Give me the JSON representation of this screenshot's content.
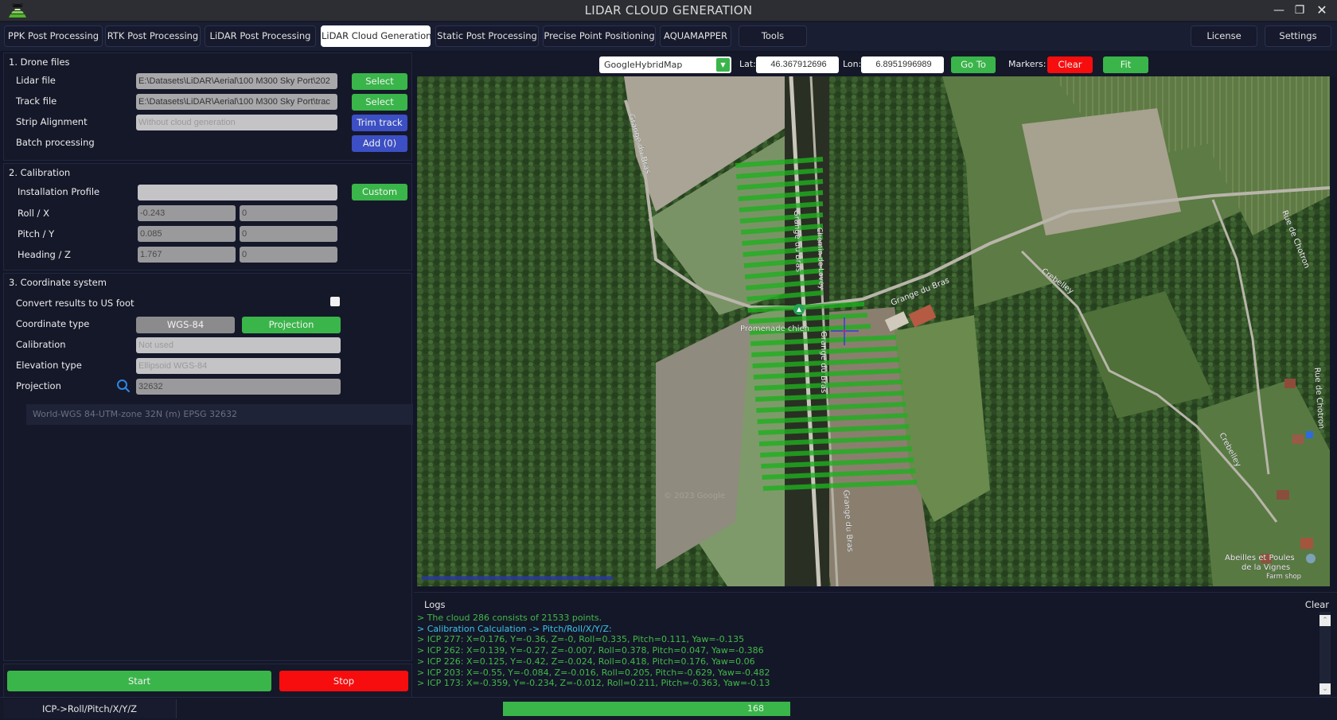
{
  "window": {
    "title": "LIDAR CLOUD GENERATION",
    "controls": {
      "minimize": "—",
      "restore": "❐",
      "close": "✕"
    }
  },
  "tabs": [
    {
      "label": "PPK Post Processing",
      "active": false
    },
    {
      "label": "RTK Post Processing",
      "active": false
    },
    {
      "label": "LiDAR Post Processing",
      "active": false
    },
    {
      "label": "LiDAR Cloud Generation",
      "active": true
    },
    {
      "label": "Static Post Processing",
      "active": false
    },
    {
      "label": "Precise Point Positioning",
      "active": false
    },
    {
      "label": "AQUAMAPPER",
      "active": false
    },
    {
      "label": "Tools",
      "active": false
    }
  ],
  "right_tabs": [
    {
      "label": "License"
    },
    {
      "label": "Settings"
    }
  ],
  "drone_files": {
    "title": "1. Drone files",
    "lidar_file": {
      "label": "Lidar file",
      "value": "E:\\Datasets\\LiDAR\\Aerial\\100 M300 Sky Port\\202",
      "button": "Select"
    },
    "track_file": {
      "label": "Track file",
      "value": "E:\\Datasets\\LiDAR\\Aerial\\100 M300 Sky Port\\trac",
      "button": "Select"
    },
    "strip_alignment": {
      "label": "Strip Alignment",
      "placeholder": "Without cloud generation",
      "button": "Trim track"
    },
    "batch_processing": {
      "label": "Batch processing",
      "button": "Add (0)"
    }
  },
  "calibration": {
    "title": "2. Calibration",
    "installation_profile": {
      "label": "Installation Profile",
      "value": "",
      "button": "Custom"
    },
    "roll": {
      "label": "Roll / X",
      "value1": "-0.243",
      "value2": "0"
    },
    "pitch": {
      "label": "Pitch / Y",
      "value1": "0.085",
      "value2": "0"
    },
    "heading": {
      "label": "Heading / Z",
      "value1": "1.767",
      "value2": "0"
    }
  },
  "coordinate_system": {
    "title": "3. Coordinate system",
    "us_foot": {
      "label": "Convert results to US foot",
      "checked": false
    },
    "coordinate_type": {
      "label": "Coordinate type",
      "option1": "WGS-84",
      "option2": "Projection",
      "selected": "Projection"
    },
    "calibration": {
      "label": "Calibration",
      "placeholder": "Not used"
    },
    "elevation_type": {
      "label": "Elevation type",
      "placeholder": "Ellipsoid WGS-84"
    },
    "projection": {
      "label": "Projection",
      "value": "32632",
      "description": "World-WGS 84-UTM-zone 32N (m) EPSG 32632"
    }
  },
  "actions": {
    "start": "Start",
    "stop": "Stop"
  },
  "map_toolbar": {
    "map_type": "GoogleHybridMap",
    "lat_label": "Lat:",
    "lat_value": "46.367912696",
    "lon_label": "Lon:",
    "lon_value": "6.8951996989",
    "goto": "Go To",
    "markers_label": "Markers:",
    "clear": "Clear",
    "fit": "Fit"
  },
  "map": {
    "labels": {
      "grange_du_bras_1": "Grange du Bras",
      "grange_du_bras_2": "Grange du Bras",
      "grange_du_bras_3": "Grange du Bras",
      "grange_du_bras_4": "Grange du Bras",
      "chemin": "Chemin de Lovey",
      "crebelley_1": "Crebelley",
      "crebelley_2": "Crebelley",
      "rue_chotron_1": "Rue de Chotron",
      "rue_chotron_2": "Rue de Chotron",
      "promenade": "Promenade chien",
      "shop_name1": "Abeilles et Poules",
      "shop_name2": "de la Vignes",
      "shop_type": "Farm shop",
      "copyright": "© 2023 Google"
    },
    "track_color": "#1fb01f",
    "crosshair_color": "#3a3adc"
  },
  "logs": {
    "title": "Logs",
    "clear": "Clear",
    "lines": [
      {
        "text": "> The cloud 286 consists of 21533 points.",
        "color": "#42b84a"
      },
      {
        "text": "> Calibration Calculation -> Pitch/Roll/X/Y/Z:",
        "color": "#3cc4e6"
      },
      {
        "text": "> ICP 277: X=0.176, Y=-0.36, Z=-0, Roll=0.335, Pitch=0.111, Yaw=-0.135",
        "color": "#42b84a"
      },
      {
        "text": "> ICP 262: X=0.139, Y=-0.27, Z=-0.007, Roll=0.378, Pitch=0.047, Yaw=-0.386",
        "color": "#42b84a"
      },
      {
        "text": "> ICP 226: X=0.125, Y=-0.42, Z=-0.024, Roll=0.418, Pitch=0.176, Yaw=0.06",
        "color": "#42b84a"
      },
      {
        "text": "> ICP 203: X=-0.55, Y=-0.084, Z=-0.016, Roll=0.205, Pitch=-0.629, Yaw=-0.482",
        "color": "#42b84a"
      },
      {
        "text": "> ICP 173: X=-0.359, Y=-0.234, Z=-0.012, Roll=0.211, Pitch=-0.363, Yaw=-0.13",
        "color": "#42b84a"
      }
    ]
  },
  "status": {
    "mode": "ICP->Roll/Pitch/X/Y/Z",
    "progress_value": "168",
    "progress_fraction": 1.0
  }
}
